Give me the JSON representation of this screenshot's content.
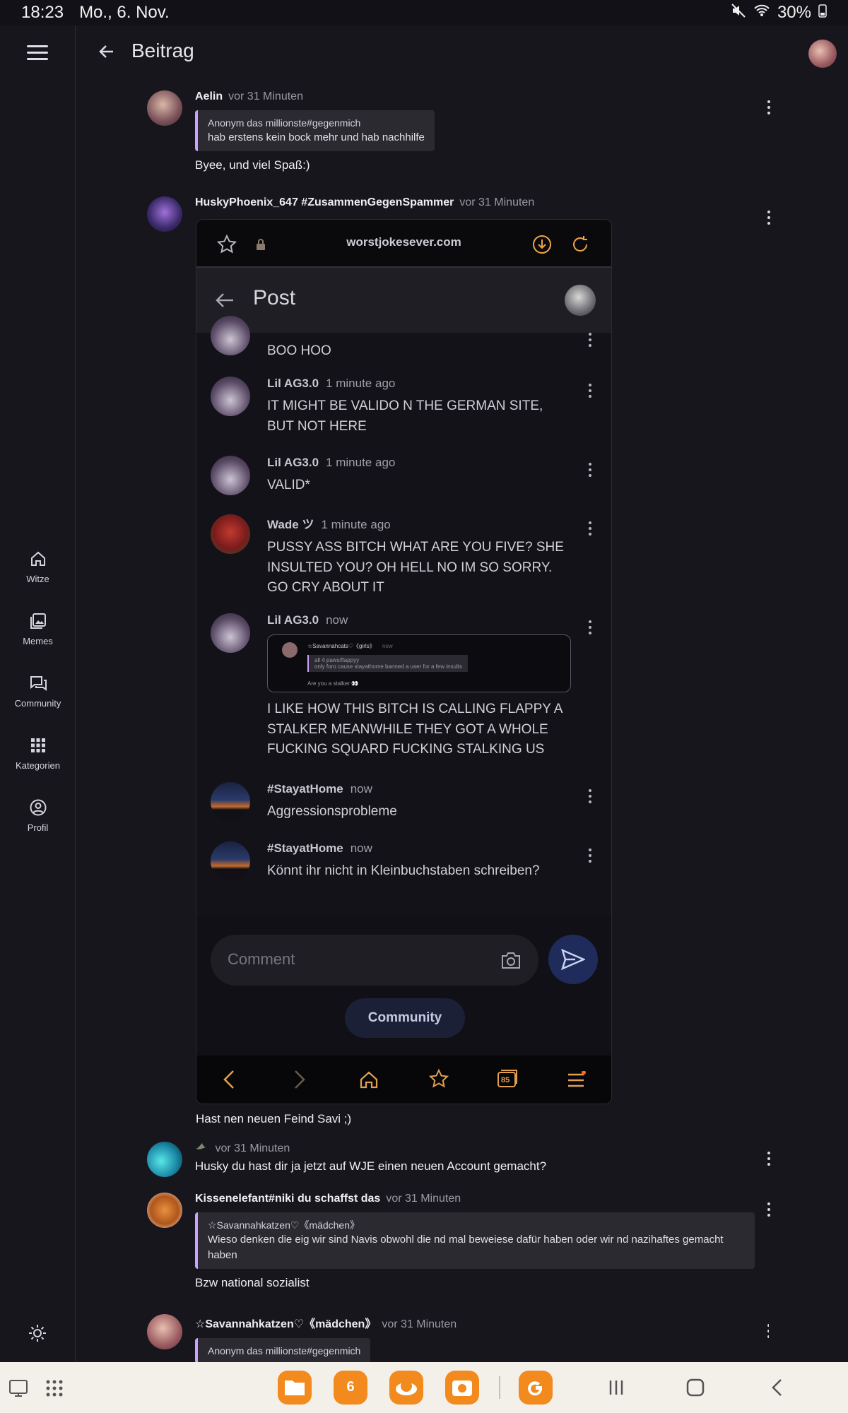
{
  "status_bar": {
    "time": "18:23",
    "date": "Mo., 6. Nov.",
    "battery": "30%"
  },
  "header": {
    "title": "Beitrag"
  },
  "sidebar": {
    "items": [
      {
        "label": "Witze",
        "icon": "home-icon"
      },
      {
        "label": "Memes",
        "icon": "image-icon"
      },
      {
        "label": "Community",
        "icon": "chat-icon"
      },
      {
        "label": "Kategorien",
        "icon": "grid-icon"
      },
      {
        "label": "Profil",
        "icon": "profile-icon"
      }
    ]
  },
  "comments": [
    {
      "author": "Aelin",
      "time": "vor 31 Minuten",
      "quote_author": "Anonym das millionste#gegenmich",
      "quote_text": "hab erstens kein bock mehr und hab nachhilfe",
      "text": "Byee, und viel Spaß:)"
    },
    {
      "author": "HuskyPhoenix_647 #ZusammenGegenSpammer",
      "time": "vor 31 Minuten",
      "text": "Hast nen neuen Feind Savi ;)"
    },
    {
      "author": "",
      "time": "vor 31 Minuten",
      "text": "Husky du hast dir ja jetzt auf WJE einen neuen Account gemacht?"
    },
    {
      "author": "Kissenelefant#niki du schaffst das",
      "time": "vor 31 Minuten",
      "quote_author": "☆Savannahkatzen♡《mädchen》",
      "quote_text": "Wieso denken die eig wir sind Navis obwohl die nd mal beweiese dafür haben oder wir nd nazihaftes gemacht haben",
      "text": "Bzw national sozialist"
    },
    {
      "author": "☆Savannahkatzen♡《mädchen》",
      "time": "vor 31 Minuten",
      "quote_author": "Anonym das millionste#gegenmich"
    }
  ],
  "embedded": {
    "url": "worstjokesever.com",
    "title": "Post",
    "partial_text": "BOO HOO",
    "items": [
      {
        "author": "Lil AG3.0",
        "time": "1 minute ago",
        "text": "IT MIGHT BE VALIDO N THE GERMAN SITE, BUT NOT HERE"
      },
      {
        "author": "Lil AG3.0",
        "time": "1 minute ago",
        "text": "VALID*"
      },
      {
        "author": "Wade ツ",
        "time": "1 minute ago",
        "text": "PUSSY ASS BITCH WHAT ARE YOU FIVE? SHE INSULTED YOU? OH HELL NO IM SO SORRY. GO CRY ABOUT IT"
      },
      {
        "author": "Lil AG3.0",
        "time": "now",
        "text": "I LIKE HOW THIS BITCH IS CALLING FLAPPY A STALKER MEANWHILE THEY GOT A WHOLE FUCKING SQUARD FUCKING STALKING US"
      },
      {
        "author": "#StayatHome",
        "time": "now",
        "text": "Aggressionsprobleme"
      },
      {
        "author": "#StayatHome",
        "time": "now",
        "text": "Könnt ihr nicht in Kleinbuchstaben schreiben?"
      }
    ],
    "mini": {
      "author": "☆Savannahcats♡《girls》",
      "time": "now",
      "quote1": "all 4 paws/flappyy",
      "quote2": "only foro cause stayathome banned a user for a few insults",
      "text": "Are you a stalker 👀"
    },
    "comment_placeholder": "Comment",
    "community_button": "Community",
    "tabs_count": "85"
  },
  "dock": {
    "calendar_day": "6"
  }
}
